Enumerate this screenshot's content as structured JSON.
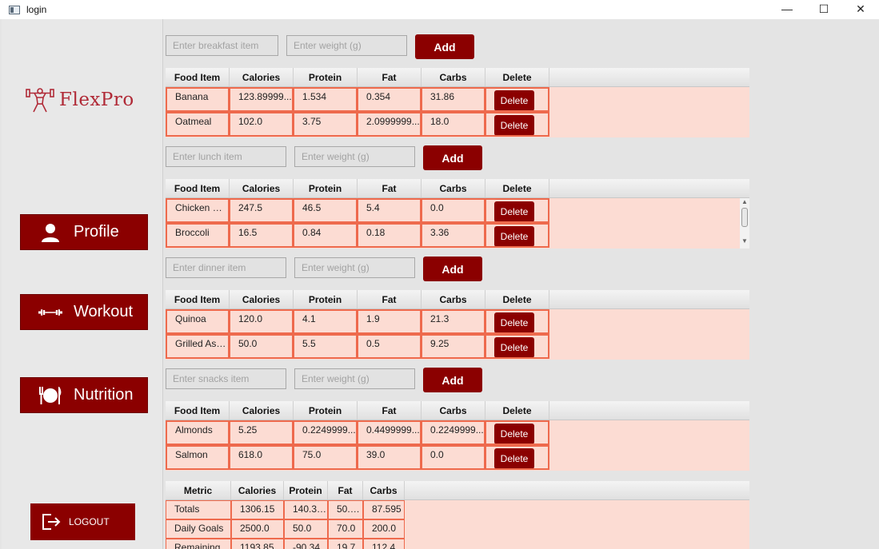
{
  "window": {
    "title": "login",
    "minimize": "—",
    "maximize": "☐",
    "close": "✕"
  },
  "sidebar": {
    "logo_text": "FlexPro",
    "nav": [
      {
        "label": "Profile",
        "icon": "user-icon"
      },
      {
        "label": "Workout",
        "icon": "dumbbell-icon"
      },
      {
        "label": "Nutrition",
        "icon": "plate-cutlery-icon"
      }
    ],
    "logout_label": "LOGOUT",
    "brand_color": "#8b0000"
  },
  "meals": [
    {
      "item_placeholder": "Enter breakfast item",
      "weight_placeholder": "Enter weight (g)",
      "add_label": "Add",
      "headers": [
        "Food Item",
        "Calories",
        "Protein",
        "Fat",
        "Carbs",
        "Delete"
      ],
      "rows": [
        {
          "food": "Banana",
          "calories": "123.89999...",
          "protein": "1.534",
          "fat": "0.354",
          "carbs": "31.86",
          "delete": "Delete"
        },
        {
          "food": "Oatmeal",
          "calories": "102.0",
          "protein": "3.75",
          "fat": "2.0999999...",
          "carbs": "18.0",
          "delete": "Delete"
        }
      ]
    },
    {
      "item_placeholder": "Enter lunch item",
      "weight_placeholder": "Enter weight (g)",
      "add_label": "Add",
      "headers": [
        "Food Item",
        "Calories",
        "Protein",
        "Fat",
        "Carbs",
        "Delete"
      ],
      "rows": [
        {
          "food": "Chicken Br...",
          "calories": "247.5",
          "protein": "46.5",
          "fat": "5.4",
          "carbs": "0.0",
          "delete": "Delete"
        },
        {
          "food": "Broccoli",
          "calories": "16.5",
          "protein": "0.84",
          "fat": "0.18",
          "carbs": "3.36",
          "delete": "Delete"
        }
      ]
    },
    {
      "item_placeholder": "Enter dinner item",
      "weight_placeholder": "Enter weight (g)",
      "add_label": "Add",
      "headers": [
        "Food Item",
        "Calories",
        "Protein",
        "Fat",
        "Carbs",
        "Delete"
      ],
      "rows": [
        {
          "food": "Quinoa",
          "calories": "120.0",
          "protein": "4.1",
          "fat": "1.9",
          "carbs": "21.3",
          "delete": "Delete"
        },
        {
          "food": "Grilled Asp...",
          "calories": "50.0",
          "protein": "5.5",
          "fat": "0.5",
          "carbs": "9.25",
          "delete": "Delete"
        }
      ]
    },
    {
      "item_placeholder": "Enter snacks item",
      "weight_placeholder": "Enter weight (g)",
      "add_label": "Add",
      "headers": [
        "Food Item",
        "Calories",
        "Protein",
        "Fat",
        "Carbs",
        "Delete"
      ],
      "rows": [
        {
          "food": "Almonds",
          "calories": "5.25",
          "protein": "0.2249999...",
          "fat": "0.4499999...",
          "carbs": "0.2249999...",
          "delete": "Delete"
        },
        {
          "food": "Salmon",
          "calories": "618.0",
          "protein": "75.0",
          "fat": "39.0",
          "carbs": "0.0",
          "delete": "Delete"
        }
      ]
    }
  ],
  "summary": {
    "headers": [
      "Metric",
      "Calories",
      "Protein",
      "Fat",
      "Carbs"
    ],
    "rows": [
      {
        "metric": "Totals",
        "calories": "1306.15",
        "protein": "140.349",
        "fat": "50.2...",
        "carbs": "87.595"
      },
      {
        "metric": "Daily Goals",
        "calories": "2500.0",
        "protein": "50.0",
        "fat": "70.0",
        "carbs": "200.0"
      },
      {
        "metric": "Remaining",
        "calories": "1193.85",
        "protein": "-90.34",
        "fat": "19.7",
        "carbs": "112.4"
      }
    ]
  }
}
